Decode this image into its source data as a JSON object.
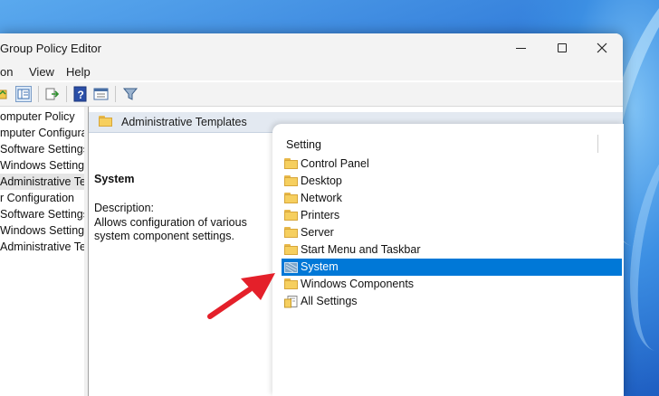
{
  "window": {
    "title": "Group Policy Editor"
  },
  "menu": [
    "on",
    "View",
    "Help"
  ],
  "tree": {
    "items": [
      {
        "label": "omputer Policy",
        "selected": false
      },
      {
        "label": "mputer Configura",
        "selected": false
      },
      {
        "label": "Software Settings",
        "selected": false
      },
      {
        "label": "Windows Setting",
        "selected": false
      },
      {
        "label": "Administrative Te",
        "selected": true
      },
      {
        "label": "r Configuration",
        "selected": false
      },
      {
        "label": "Software Settings",
        "selected": false
      },
      {
        "label": "Windows Setting",
        "selected": false
      },
      {
        "label": "Administrative Te",
        "selected": false
      }
    ]
  },
  "header": {
    "title": "Administrative Templates"
  },
  "description": {
    "title": "System",
    "label": "Description:",
    "text": "Allows configuration of various system component settings."
  },
  "settings": {
    "column": "Setting",
    "rows": [
      {
        "label": "Control Panel",
        "icon": "folder-icon",
        "selected": false
      },
      {
        "label": "Desktop",
        "icon": "folder-icon",
        "selected": false
      },
      {
        "label": "Network",
        "icon": "folder-icon",
        "selected": false
      },
      {
        "label": "Printers",
        "icon": "folder-icon",
        "selected": false
      },
      {
        "label": "Server",
        "icon": "folder-icon",
        "selected": false
      },
      {
        "label": "Start Menu and Taskbar",
        "icon": "folder-icon",
        "selected": false
      },
      {
        "label": "System",
        "icon": "folder-icon",
        "selected": true
      },
      {
        "label": "Windows Components",
        "icon": "folder-icon",
        "selected": false
      },
      {
        "label": "All Settings",
        "icon": "all-settings-icon",
        "selected": false
      }
    ]
  },
  "colors": {
    "selection": "#0078d7",
    "annotation_arrow": "#e4202a"
  }
}
